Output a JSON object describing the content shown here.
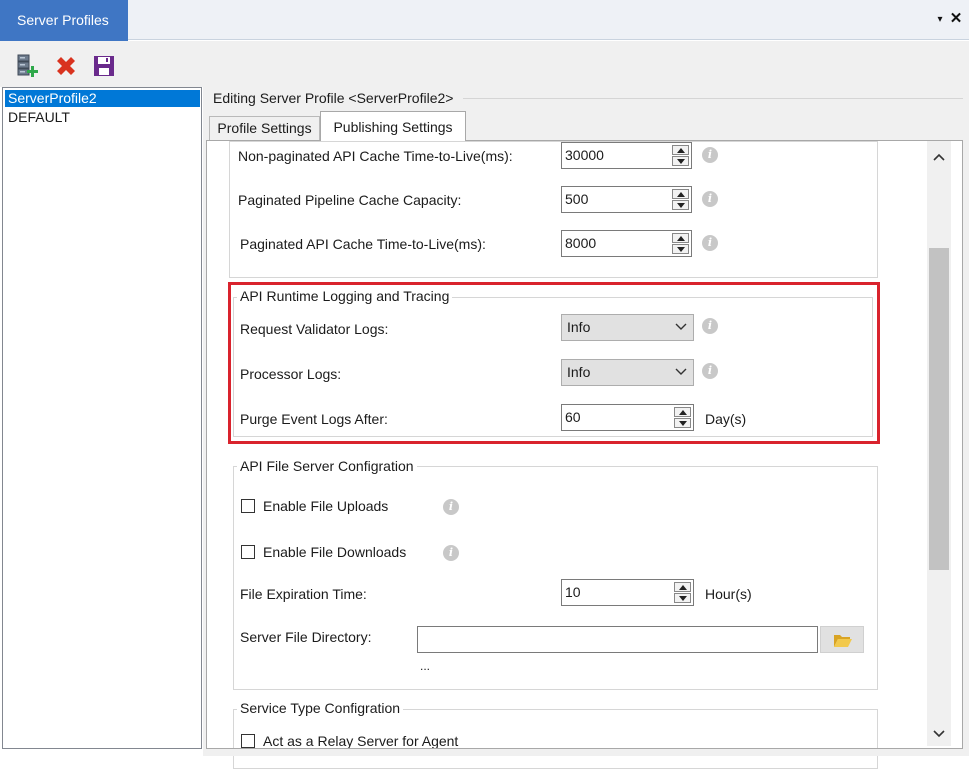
{
  "window": {
    "title": "Server Profiles",
    "pin_glyph": "▾",
    "close_glyph": "✕"
  },
  "toolbar": {
    "add_icon": "add-server-icon",
    "delete_icon": "delete-x-icon",
    "save_icon": "floppy-save-icon"
  },
  "profiles": [
    "ServerProfile2",
    "DEFAULT"
  ],
  "editing_label": "Editing Server Profile <ServerProfile2>",
  "tabs": [
    "Profile Settings",
    "Publishing Settings"
  ],
  "cache": {
    "nonpaginated_ttl_label": "Non-paginated API Cache Time-to-Live(ms):",
    "nonpaginated_ttl_value": "30000",
    "paginated_capacity_label": "Paginated Pipeline Cache Capacity:",
    "paginated_capacity_value": "500",
    "paginated_ttl_label": "Paginated API Cache Time-to-Live(ms):",
    "paginated_ttl_value": "8000"
  },
  "logging": {
    "title": "API Runtime Logging and Tracing",
    "request_validator_label": "Request Validator Logs:",
    "request_validator_value": "Info",
    "processor_label": "Processor Logs:",
    "processor_value": "Info",
    "purge_label": "Purge Event Logs After:",
    "purge_value": "60",
    "purge_unit": "Day(s)"
  },
  "file_server": {
    "title": "API File Server Configration",
    "enable_uploads_label": "Enable File Uploads",
    "enable_downloads_label": "Enable File Downloads",
    "expiration_label": "File Expiration Time:",
    "expiration_value": "10",
    "expiration_unit": "Hour(s)",
    "directory_label": "Server File Directory:",
    "directory_value": "",
    "ellipsis": "..."
  },
  "service_type": {
    "title": "Service Type Configration",
    "relay_label": "Act as a Relay Server for Agent"
  },
  "colors": {
    "title_tab": "#3f76c4",
    "selection": "#0078d7",
    "highlight_border": "#d9232d",
    "delete_red": "#d9331f",
    "save_purple": "#6a2a8c"
  }
}
